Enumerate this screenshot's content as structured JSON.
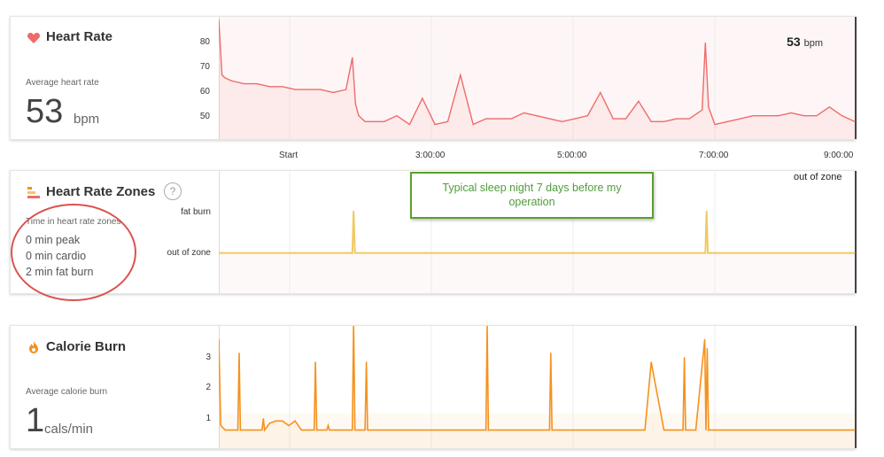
{
  "heart_rate": {
    "title": "Heart Rate",
    "avg_label": "Average heart rate",
    "avg_value": "53",
    "avg_unit": "bpm",
    "current_value": "53",
    "current_unit": "bpm",
    "y_ticks": [
      "80",
      "70",
      "60",
      "50"
    ],
    "color": "#ef6b6b"
  },
  "x_ticks": [
    "Start",
    "3:00:00",
    "5:00:00",
    "7:00:00",
    "9:00:00"
  ],
  "zones": {
    "title": "Heart Rate Zones",
    "help": "?",
    "time_label": "Time in heart rate zones",
    "lines": [
      "0 min peak",
      "0 min cardio",
      "2 min fat burn"
    ],
    "y_labels": [
      "fat burn",
      "out of zone"
    ],
    "current_zone": "out of zone",
    "color": "#f0c962"
  },
  "annotation": "Typical sleep night 7 days before my operation",
  "calories": {
    "title": "Calorie Burn",
    "avg_label": "Average calorie burn",
    "avg_value": "1",
    "avg_unit": "cals/min",
    "y_ticks": [
      "3",
      "2",
      "1"
    ],
    "color": "#f5921e"
  },
  "chart_data": [
    {
      "type": "line",
      "title": "Heart Rate",
      "ylabel": "bpm",
      "ylim": [
        44,
        86
      ],
      "x": [
        0,
        0.5,
        1,
        2,
        4,
        6,
        8,
        10,
        12,
        14,
        16,
        18,
        20,
        21,
        21.5,
        22,
        23,
        24,
        26,
        28,
        30,
        32,
        34,
        36,
        38,
        40,
        42,
        44,
        46,
        48,
        50,
        52,
        54,
        56,
        58,
        60,
        62,
        64,
        66,
        68,
        70,
        72,
        74,
        76,
        76.5,
        77,
        78,
        80,
        82,
        84,
        86,
        88,
        90,
        92,
        94,
        96,
        98,
        100
      ],
      "series": [
        {
          "values": [
            85,
            66,
            65,
            64,
            63,
            63,
            62,
            62,
            61,
            61,
            61,
            60,
            61,
            72,
            56,
            52,
            50,
            50,
            50,
            52,
            49,
            58,
            49,
            50,
            66,
            49,
            51,
            51,
            51,
            53,
            52,
            51,
            50,
            51,
            52,
            60,
            51,
            51,
            57,
            50,
            50,
            51,
            51,
            54,
            77,
            55,
            49,
            50,
            51,
            52,
            52,
            52,
            53,
            52,
            52,
            55,
            52,
            50
          ]
        }
      ]
    },
    {
      "type": "line",
      "title": "Heart Rate Zones",
      "categories": [
        "out of zone",
        "fat burn"
      ],
      "x": [
        0,
        21,
        21.2,
        21.4,
        76.5,
        76.7,
        76.9,
        100
      ],
      "series": [
        {
          "values": [
            "out of zone",
            "out of zone",
            "fat burn",
            "out of zone",
            "out of zone",
            "fat burn",
            "out of zone",
            "out of zone"
          ]
        }
      ]
    },
    {
      "type": "line",
      "title": "Calorie Burn",
      "ylabel": "cals/min",
      "ylim": [
        0.7,
        3.4
      ],
      "x": [
        0,
        0.3,
        1,
        2,
        3,
        3.2,
        3.4,
        5,
        6.8,
        7,
        7.2,
        8,
        9,
        10,
        11,
        12,
        13,
        14,
        15,
        15.2,
        15.4,
        17,
        17.2,
        17.4,
        21,
        21.2,
        21.4,
        23,
        23.2,
        23.4,
        25,
        27,
        30,
        32,
        40,
        42,
        42.2,
        42.4,
        50,
        52,
        52.2,
        52.4,
        55,
        60,
        61,
        65,
        67,
        68,
        70,
        73,
        73.2,
        73.4,
        75,
        76.4,
        76.6,
        76.8,
        77,
        77.3,
        78,
        80,
        90,
        91,
        92,
        95,
        100
      ],
      "series": [
        {
          "values": [
            3.1,
            1.2,
            1.1,
            1.1,
            1.1,
            2.8,
            1.1,
            1.1,
            1.1,
            1.35,
            1.1,
            1.25,
            1.3,
            1.3,
            1.2,
            1.3,
            1.1,
            1.1,
            1.1,
            2.6,
            1.1,
            1.1,
            1.2,
            1.1,
            1.1,
            3.5,
            1.1,
            1.1,
            2.6,
            1.1,
            1.1,
            1.1,
            1.1,
            1.1,
            1.1,
            1.1,
            3.4,
            1.1,
            1.1,
            1.1,
            2.8,
            1.1,
            1.1,
            1.1,
            1.1,
            1.1,
            1.1,
            2.6,
            1.1,
            1.1,
            2.7,
            1.1,
            1.1,
            3.1,
            1.1,
            2.9,
            1.1,
            1.1,
            1.1,
            1.1,
            1.1,
            1.1,
            1.1,
            1.1,
            1.1
          ]
        }
      ]
    }
  ]
}
